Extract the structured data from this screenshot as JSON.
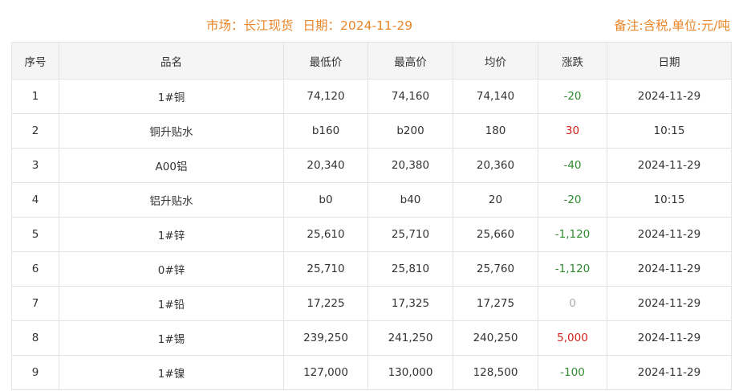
{
  "header": {
    "market_label": "市场：长江现货",
    "date_label": "日期：2024-11-29",
    "note": "备注:含税,单位:元/吨"
  },
  "colors": {
    "header_accent": "#e8862a",
    "down": "#2e8b2e",
    "up": "#d0211c",
    "flat": "#aaaaaa"
  },
  "table": {
    "columns": [
      "序号",
      "品名",
      "最低价",
      "最高价",
      "均价",
      "涨跌",
      "日期"
    ],
    "rows": [
      {
        "no": "1",
        "name": "1#铜",
        "low": "74,120",
        "high": "74,160",
        "avg": "74,140",
        "change": "-20",
        "trend": "down",
        "date": "2024-11-29"
      },
      {
        "no": "2",
        "name": "铜升贴水",
        "low": "b160",
        "high": "b200",
        "avg": "180",
        "change": "30",
        "trend": "up",
        "date": "10:15"
      },
      {
        "no": "3",
        "name": "A00铝",
        "low": "20,340",
        "high": "20,380",
        "avg": "20,360",
        "change": "-40",
        "trend": "down",
        "date": "2024-11-29"
      },
      {
        "no": "4",
        "name": "铝升贴水",
        "low": "b0",
        "high": "b40",
        "avg": "20",
        "change": "-20",
        "trend": "down",
        "date": "10:15"
      },
      {
        "no": "5",
        "name": "1#锌",
        "low": "25,610",
        "high": "25,710",
        "avg": "25,660",
        "change": "-1,120",
        "trend": "down",
        "date": "2024-11-29"
      },
      {
        "no": "6",
        "name": "0#锌",
        "low": "25,710",
        "high": "25,810",
        "avg": "25,760",
        "change": "-1,120",
        "trend": "down",
        "date": "2024-11-29"
      },
      {
        "no": "7",
        "name": "1#铅",
        "low": "17,225",
        "high": "17,325",
        "avg": "17,275",
        "change": "0",
        "trend": "flat",
        "date": "2024-11-29"
      },
      {
        "no": "8",
        "name": "1#锡",
        "low": "239,250",
        "high": "241,250",
        "avg": "240,250",
        "change": "5,000",
        "trend": "up",
        "date": "2024-11-29"
      },
      {
        "no": "9",
        "name": "1#镍",
        "low": "127,000",
        "high": "130,000",
        "avg": "128,500",
        "change": "-100",
        "trend": "down",
        "date": "2024-11-29"
      }
    ]
  }
}
